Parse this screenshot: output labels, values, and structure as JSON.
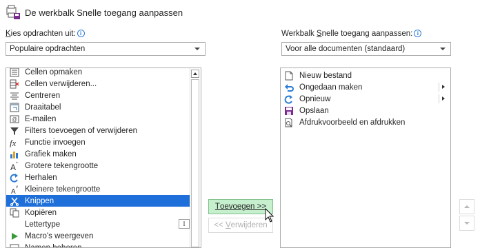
{
  "dialog": {
    "title": "De werkbalk Snelle toegang aanpassen"
  },
  "left": {
    "label_prefix": "K",
    "label_rest": "ies opdrachten uit:",
    "dropdown_value": "Populaire opdrachten",
    "items": [
      {
        "label": "Cellen opmaken",
        "icon": "format-cells-icon"
      },
      {
        "label": "Cellen verwijderen...",
        "icon": "delete-cells-icon"
      },
      {
        "label": "Centreren",
        "icon": "center-align-icon"
      },
      {
        "label": "Draaitabel",
        "icon": "pivot-table-icon"
      },
      {
        "label": "E-mailen",
        "icon": "email-icon"
      },
      {
        "label": "Filters toevoegen of verwijderen",
        "icon": "filter-icon"
      },
      {
        "label": "Functie invoegen",
        "icon": "function-icon"
      },
      {
        "label": "Grafiek maken",
        "icon": "chart-icon"
      },
      {
        "label": "Grotere tekengrootte",
        "icon": "font-grow-icon"
      },
      {
        "label": "Herhalen",
        "icon": "redo-icon"
      },
      {
        "label": "Kleinere tekengrootte",
        "icon": "font-shrink-icon"
      },
      {
        "label": "Knippen",
        "icon": "cut-icon"
      },
      {
        "label": "Kopiëren",
        "icon": "copy-icon"
      },
      {
        "label": "Lettertype",
        "icon": "none"
      },
      {
        "label": "Macro's weergeven",
        "icon": "macro-play-icon"
      },
      {
        "label": "Namen beheren",
        "icon": "name-manager-icon"
      }
    ],
    "lettertype_button": "I"
  },
  "right": {
    "label_prefix": "Werkbalk ",
    "label_underlined": "S",
    "label_rest": "nelle toegang aanpassen:",
    "dropdown_value": "Voor alle documenten (standaard)",
    "items": [
      {
        "label": "Nieuw bestand",
        "icon": "new-file-icon"
      },
      {
        "label": "Ongedaan maken",
        "icon": "undo-icon"
      },
      {
        "label": "Opnieuw",
        "icon": "redo-icon"
      },
      {
        "label": "Opslaan",
        "icon": "save-icon"
      },
      {
        "label": "Afdrukvoorbeeld en afdrukken",
        "icon": "print-preview-icon"
      }
    ]
  },
  "buttons": {
    "add_underlined": "T",
    "add_rest": "oevoegen >>",
    "remove_prefix": "<< ",
    "remove_underlined": "V",
    "remove_rest": "erwijderen"
  },
  "colors": {
    "selection": "#1e6fd9",
    "add_button": "#c6efce"
  }
}
